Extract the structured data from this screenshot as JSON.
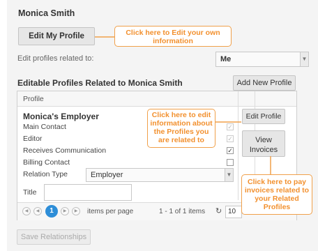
{
  "header": {
    "user_name": "Monica Smith"
  },
  "profile": {
    "edit_my_profile_label": "Edit My Profile"
  },
  "related": {
    "label": "Edit profiles related to:",
    "selected": "Me"
  },
  "section": {
    "title": "Editable Profiles Related to Monica Smith",
    "add_button": "Add New Profile"
  },
  "grid": {
    "column_header": "Profile",
    "employer_name": "Monica's Employer",
    "rows": [
      {
        "label": "Main Contact",
        "checked": true,
        "disabled": true
      },
      {
        "label": "Editor",
        "checked": true,
        "disabled": true
      },
      {
        "label": "Receives Communication",
        "checked": true,
        "disabled": false
      },
      {
        "label": "Billing Contact",
        "checked": false,
        "disabled": false
      }
    ],
    "relation_label": "Relation Type",
    "relation_value": "Employer",
    "title_label": "Title",
    "title_value": "",
    "edit_profile_button": "Edit Profile",
    "view_invoices_button": "View Invoices",
    "pager": {
      "current_page": "1",
      "items_per_page_label": "items per page",
      "range_text": "1 - 1 of 1 items",
      "page_size": "10"
    }
  },
  "callouts": {
    "edit_own": "Click here to Edit your own information",
    "edit_related": "Click here to edit information about the Profiles you are related to",
    "pay_invoices": "Click here to pay invoices related to your Related Profiles"
  },
  "footer": {
    "save_button": "Save Relationships"
  },
  "colors": {
    "callout": "#f2902e",
    "pager_active": "#2e8ed8"
  },
  "icons": [
    "first-page-icon",
    "prev-page-icon",
    "next-page-icon",
    "last-page-icon",
    "refresh-icon",
    "dropdown-arrow-icon",
    "checkmark-icon"
  ]
}
